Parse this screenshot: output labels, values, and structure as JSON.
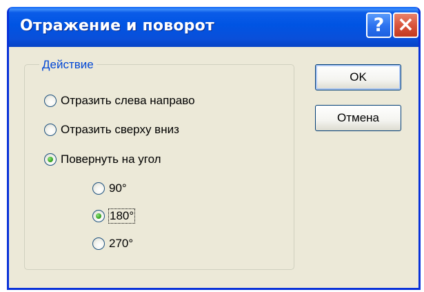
{
  "window": {
    "title": "Отражение и поворот",
    "help_glyph": "?",
    "close_glyph": "×"
  },
  "action_group": {
    "legend": "Действие",
    "options": [
      {
        "label": "Отразить слева направо",
        "checked": false
      },
      {
        "label": "Отразить сверху вниз",
        "checked": false
      },
      {
        "label": "Повернуть на угол",
        "checked": true
      }
    ],
    "angles": [
      {
        "label": "90°",
        "checked": false
      },
      {
        "label": "180°",
        "checked": true
      },
      {
        "label": "270°",
        "checked": false
      }
    ]
  },
  "buttons": {
    "ok_label": "OK",
    "cancel_label": "Отмена"
  },
  "colors": {
    "titlebar": "#0054e3",
    "dialog_bg": "#ece9d8",
    "legend_text": "#0046d5",
    "close_button": "#d9543c",
    "radio_checked": "#3aa626"
  }
}
